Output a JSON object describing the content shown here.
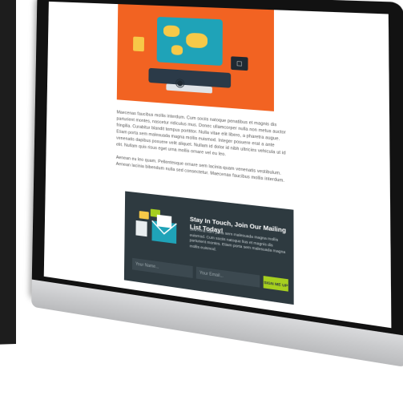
{
  "article": {
    "paragraph_1": "Maecenas faucibus mollis interdum. Cum sociis natoque penatibus et magnis dis parturient montes, nascetur ridiculus mus. Donec ullamcorper nulla non metus auctor fringilla. Curabitur blandit tempus porttitor. Nulla vitae elit libero, a pharetra augue. Etiam porta sem malesuada magna mollis euismod. Integer posuere erat a ante venenatis dapibus posuere velit aliquet. Nullam id dolor id nibh ultricies vehicula ut id elit. Nullam quis risus eget urna mollis ornare vel eu leo.",
    "paragraph_2": "Aenean eu leo quam. Pellentesque ornare sem lacinia quam venenatis vestibulum. Aenean lacinia bibendum nulla sed consectetur. Maecenas faucibus mollis interdum."
  },
  "signup": {
    "title": "Stay In Touch, Join Our Mailing List Today!",
    "description": "Sed Ama nam porta sem malesuada magna mollis euismod. Cum sociis natoque lius et magnis dis parturient montes. Etiam porta sem malesuada magna mollis euismod.",
    "name_placeholder": "Your Name...",
    "email_placeholder": "Your Email...",
    "button_label": "SIGN ME UP"
  },
  "colors": {
    "hero_background": "#f26322",
    "signup_background": "#2e3a40",
    "signup_button": "#a6cf1f",
    "bezel": "#121212"
  },
  "icons": [
    "map-icon",
    "envelope-icon",
    "chat-bubbles-icon",
    "camera-icon",
    "briefcase-icon"
  ]
}
